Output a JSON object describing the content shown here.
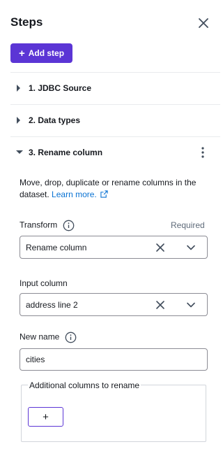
{
  "panel": {
    "title": "Steps",
    "add_step_label": "Add step"
  },
  "steps": [
    {
      "label": "1. JDBC Source",
      "expanded": false
    },
    {
      "label": "2. Data types",
      "expanded": false
    },
    {
      "label": "3. Rename column",
      "expanded": true
    }
  ],
  "rename_step": {
    "description": "Move, drop, duplicate or rename columns in the dataset.",
    "learn_more": "Learn more.",
    "transform": {
      "label": "Transform",
      "required": "Required",
      "value": "Rename column"
    },
    "input_column": {
      "label": "Input column",
      "value": "address line 2"
    },
    "new_name": {
      "label": "New name",
      "value": "cities"
    },
    "additional_columns": {
      "label": "Additional columns to rename",
      "add_symbol": "+"
    }
  },
  "colors": {
    "accent": "#5b35d5",
    "link": "#0972d3",
    "border": "#8c8c94",
    "divider": "#e9ebed"
  }
}
